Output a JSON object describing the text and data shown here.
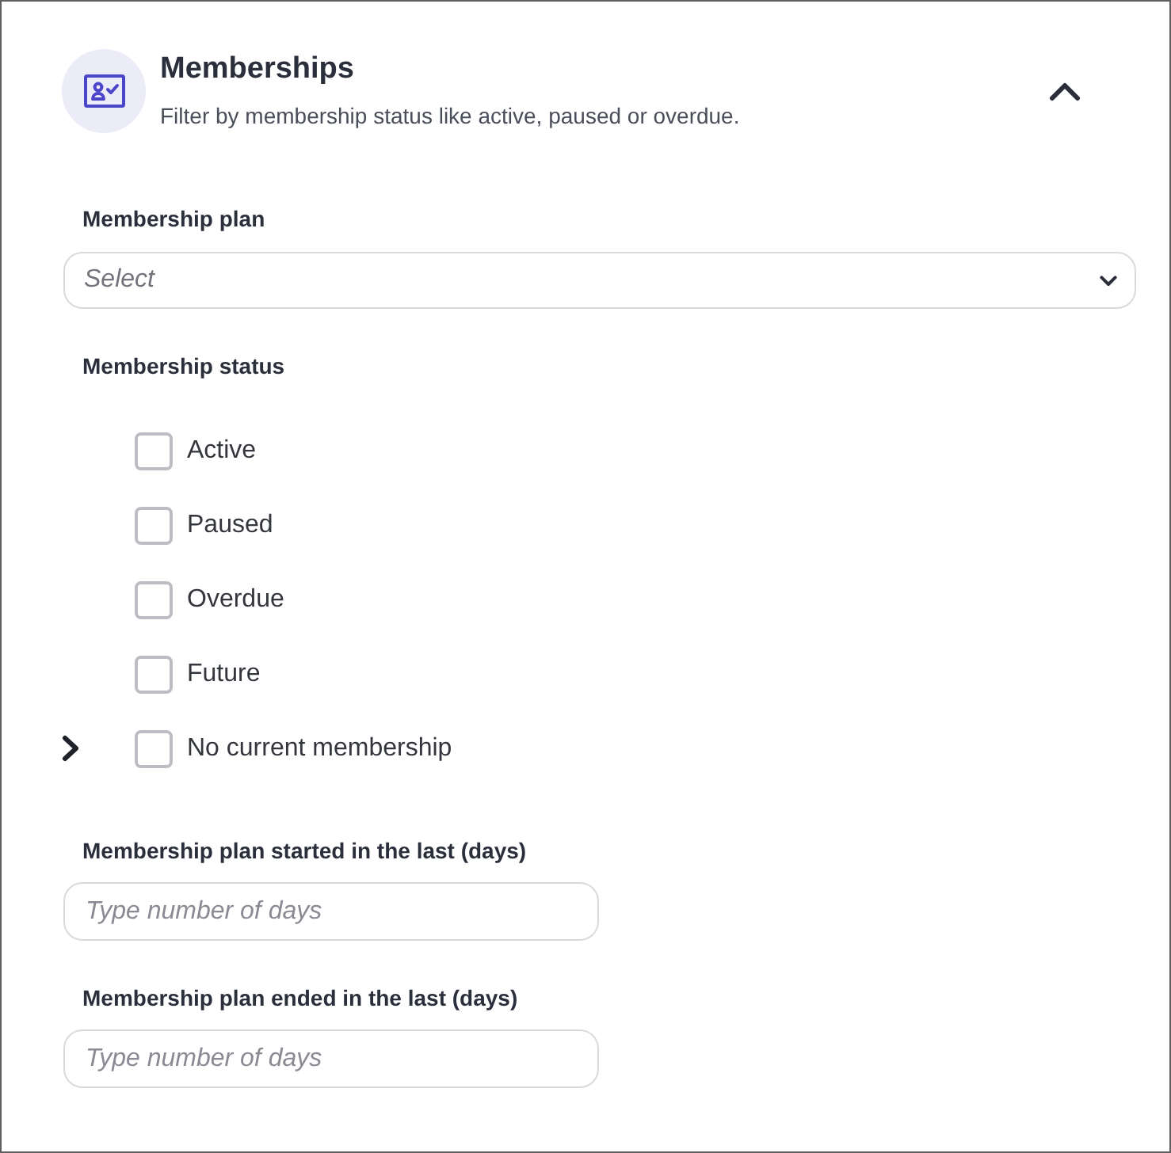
{
  "section": {
    "title": "Memberships",
    "subtitle": "Filter by membership status like active, paused or overdue.",
    "expanded": true
  },
  "plan_filter": {
    "label": "Membership plan",
    "placeholder": "Select"
  },
  "status_filter": {
    "label": "Membership status",
    "options": [
      {
        "label": "Active",
        "checked": false,
        "kind": "plain"
      },
      {
        "label": "Paused",
        "checked": false,
        "kind": "plain"
      },
      {
        "label": "Overdue",
        "checked": false,
        "kind": "plain"
      },
      {
        "label": "Future",
        "checked": false,
        "kind": "plain"
      },
      {
        "label": "No current membership",
        "checked": false,
        "kind": "expandable"
      }
    ]
  },
  "day_filters": [
    {
      "label": "Membership plan started in the last (days)",
      "placeholder": "Type number of days"
    },
    {
      "label": "Membership plan ended in the last (days)",
      "placeholder": "Type number of days"
    }
  ]
}
